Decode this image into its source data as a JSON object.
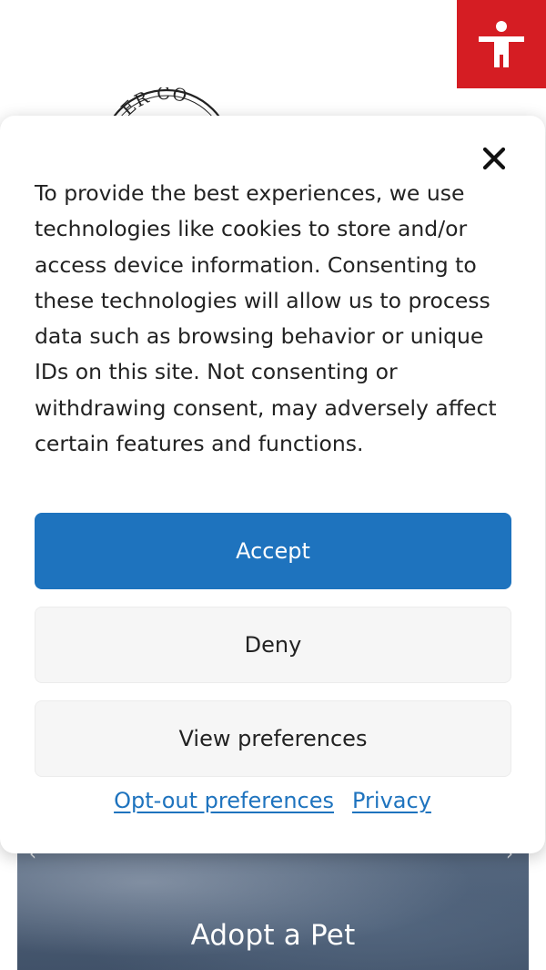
{
  "background": {
    "logo_text": "ER CO",
    "hero_title": "Adopt a Pet",
    "carousel": {
      "prev_glyph": "‹",
      "next_glyph": "›"
    },
    "accessibility_button": {
      "icon": "accessibility-person-icon",
      "color": "#d51d23"
    }
  },
  "consent": {
    "message": "To provide the best experiences, we use technologies like cookies to store and/or access device information. Consenting to these technologies will allow us to process data such as browsing behavior or unique IDs on this site. Not consenting or withdrawing consent, may adversely affect certain features and functions.",
    "close_icon": "close-icon",
    "accept_label": "Accept",
    "deny_label": "Deny",
    "preferences_label": "View preferences",
    "links": {
      "opt_out": "Opt-out preferences",
      "privacy": "Privacy"
    },
    "colors": {
      "accent": "#1e73be",
      "secondary_button": "#f6f6f6"
    }
  }
}
